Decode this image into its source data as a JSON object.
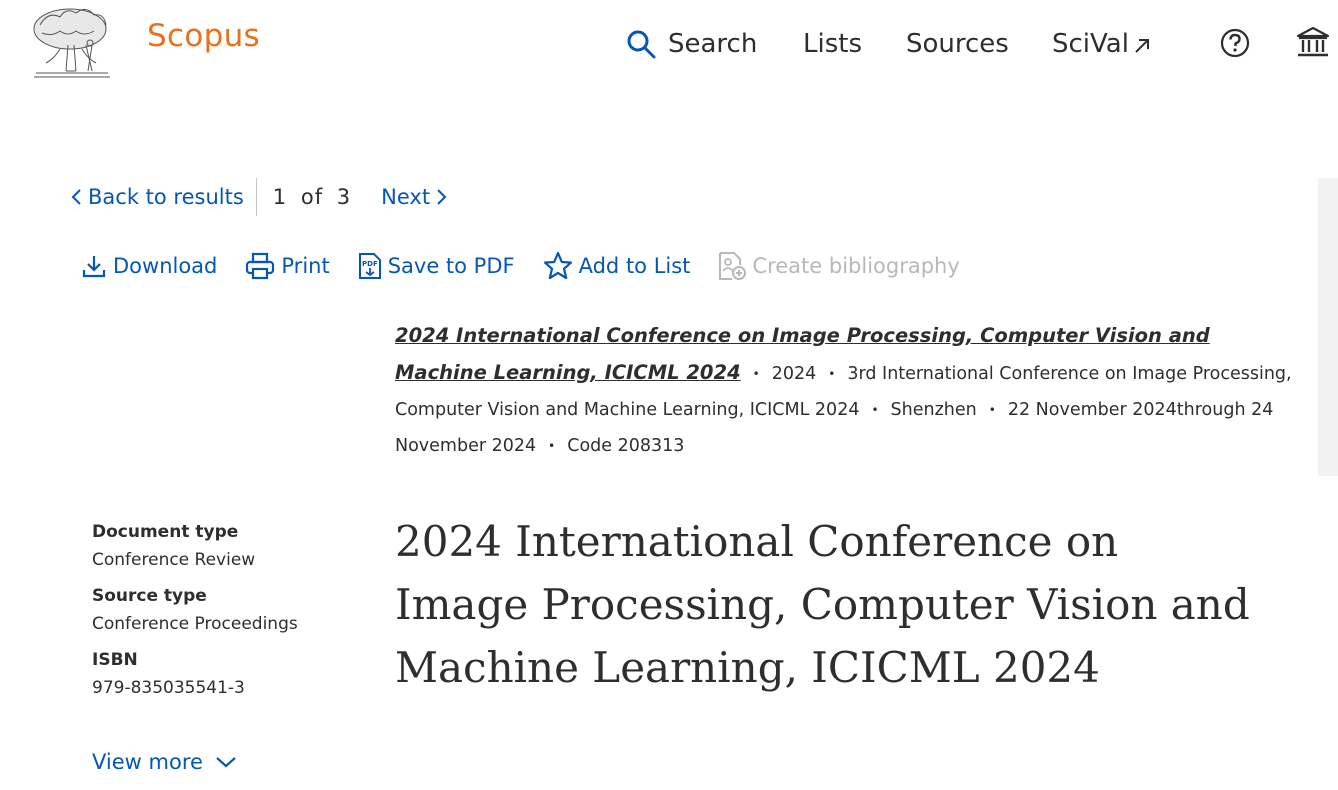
{
  "header": {
    "brand": "Scopus",
    "nav": {
      "search": "Search",
      "lists": "Lists",
      "sources": "Sources",
      "scival": "SciVal"
    }
  },
  "result_nav": {
    "back": "Back to results",
    "current": "1",
    "of": "of",
    "total": "3",
    "next": "Next"
  },
  "toolbar": {
    "download": "Download",
    "print": "Print",
    "save_pdf": "Save to PDF",
    "add_list": "Add to List",
    "create_bib": "Create bibliography"
  },
  "citation": {
    "source_title": "2024 International Conference on Image Processing, Computer Vision and Machine Learning, ICICML 2024",
    "year": "2024",
    "conference": "3rd International Conference on Image Processing, Computer Vision and Machine Learning, ICICML 2024",
    "location": "Shenzhen",
    "dates": "22 November 2024through 24 November 2024",
    "code": "Code 208313"
  },
  "details": {
    "doc_type_label": "Document type",
    "doc_type_value": "Conference Review",
    "source_type_label": "Source type",
    "source_type_value": "Conference Proceedings",
    "isbn_label": "ISBN",
    "isbn_value": "979-835035541-3",
    "view_more": "View more"
  },
  "title": "2024 International Conference on Image Processing, Computer Vision and Machine Learning, ICICML 2024",
  "colors": {
    "brand": "#e9711c",
    "link": "#0656b4",
    "text": "#2e2e2e",
    "disabled": "#b8b8b8"
  }
}
